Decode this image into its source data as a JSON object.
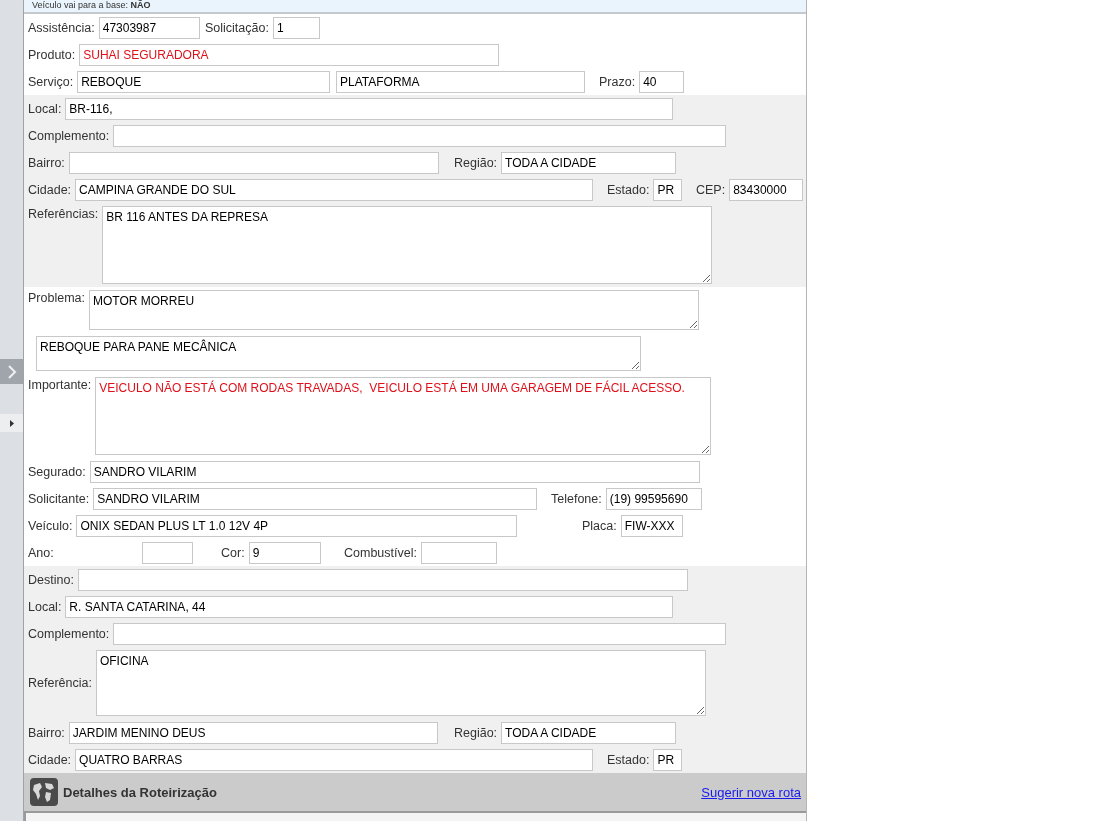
{
  "banner": "Veículo vai para a base: **NÃO**",
  "sections": [
    {
      "kind": "plain",
      "rows": [
        {
          "fields": [
            {
              "label": "Assistência:",
              "value": "47303987"
            },
            {
              "label": "Solicitação:",
              "value": "1"
            }
          ]
        },
        {
          "fields": [
            {
              "label": "Produto:",
              "value": "SUHAI SEGURADORA",
              "alert": true
            }
          ]
        },
        {
          "fields": [
            {
              "label": "Serviço:",
              "value": "REBOQUE"
            },
            {
              "value": "PLATAFORMA"
            },
            {
              "label": "Prazo:",
              "value": "40"
            }
          ]
        }
      ]
    },
    {
      "kind": "shaded",
      "rows": [
        {
          "fields": [
            {
              "label": "Local:",
              "value": "BR-116,"
            }
          ]
        },
        {
          "fields": [
            {
              "label": "Complemento:"
            }
          ]
        },
        {
          "fields": [
            {
              "label": "Bairro:"
            },
            {
              "label": "Região:",
              "value": "TODA A CIDADE"
            }
          ]
        },
        {
          "fields": [
            {
              "label": "Cidade:",
              "value": "CAMPINA GRANDE DO SUL"
            },
            {
              "label": "Estado:",
              "value": "PR"
            },
            {
              "label": "CEP:",
              "value": "83430000"
            }
          ]
        },
        {
          "fields": [
            {
              "kind": "textarea",
              "label": "Referências:",
              "value": "BR 116 ANTES DA REPRESA"
            }
          ]
        }
      ]
    },
    {
      "kind": "plain",
      "rows": [
        {
          "fields": [
            {
              "kind": "textarea",
              "label": "Problema:",
              "value": "MOTOR MORREU"
            }
          ]
        },
        {
          "fields": [
            {
              "kind": "textarea",
              "value": "REBOQUE PARA PANE MECÂNICA"
            }
          ]
        },
        {
          "fields": [
            {
              "kind": "textarea",
              "label": "Importante:",
              "value": "VEICULO NÃO ESTÁ COM RODAS TRAVADAS,  VEICULO ESTÁ EM UMA GARAGEM DE FÁCIL ACESSO.",
              "alert": true
            }
          ]
        },
        {
          "fields": [
            {
              "label": "Segurado:",
              "value": "SANDRO VILARIM"
            }
          ]
        },
        {
          "fields": [
            {
              "label": "Solicitante:",
              "value": "SANDRO VILARIM"
            },
            {
              "label": "Telefone:",
              "value": "(19) 99595690"
            }
          ]
        },
        {
          "fields": [
            {
              "label": "Veículo:",
              "value": "ONIX SEDAN PLUS LT 1.0 12V 4P"
            },
            {
              "label": "Placa:",
              "value": "FIW-XXX"
            }
          ]
        },
        {
          "fields": [
            {
              "label": "Ano:"
            },
            {
              "label": "Cor:",
              "value": "9"
            },
            {
              "label": "Combustível:"
            }
          ]
        }
      ]
    },
    {
      "kind": "shaded",
      "rows": [
        {
          "fields": [
            {
              "label": "Destino:"
            }
          ]
        },
        {
          "fields": [
            {
              "label": "Local:",
              "value": "R. SANTA CATARINA, 44"
            }
          ]
        },
        {
          "fields": [
            {
              "label": "Complemento:"
            }
          ]
        },
        {
          "fields": [
            {
              "kind": "textarea",
              "label": "Referência:",
              "value": "OFICINA"
            }
          ]
        },
        {
          "fields": [
            {
              "label": "Bairro:",
              "value": "JARDIM MENINO DEUS"
            },
            {
              "label": "Região:",
              "value": "TODA A CIDADE"
            }
          ]
        },
        {
          "fields": [
            {
              "label": "Cidade:",
              "value": "QUATRO BARRAS"
            },
            {
              "label": "Estado:",
              "value": "PR"
            }
          ]
        }
      ]
    }
  ],
  "routing": {
    "title": "Detalhes da Roteirização",
    "link": "Sugerir nova rota"
  }
}
